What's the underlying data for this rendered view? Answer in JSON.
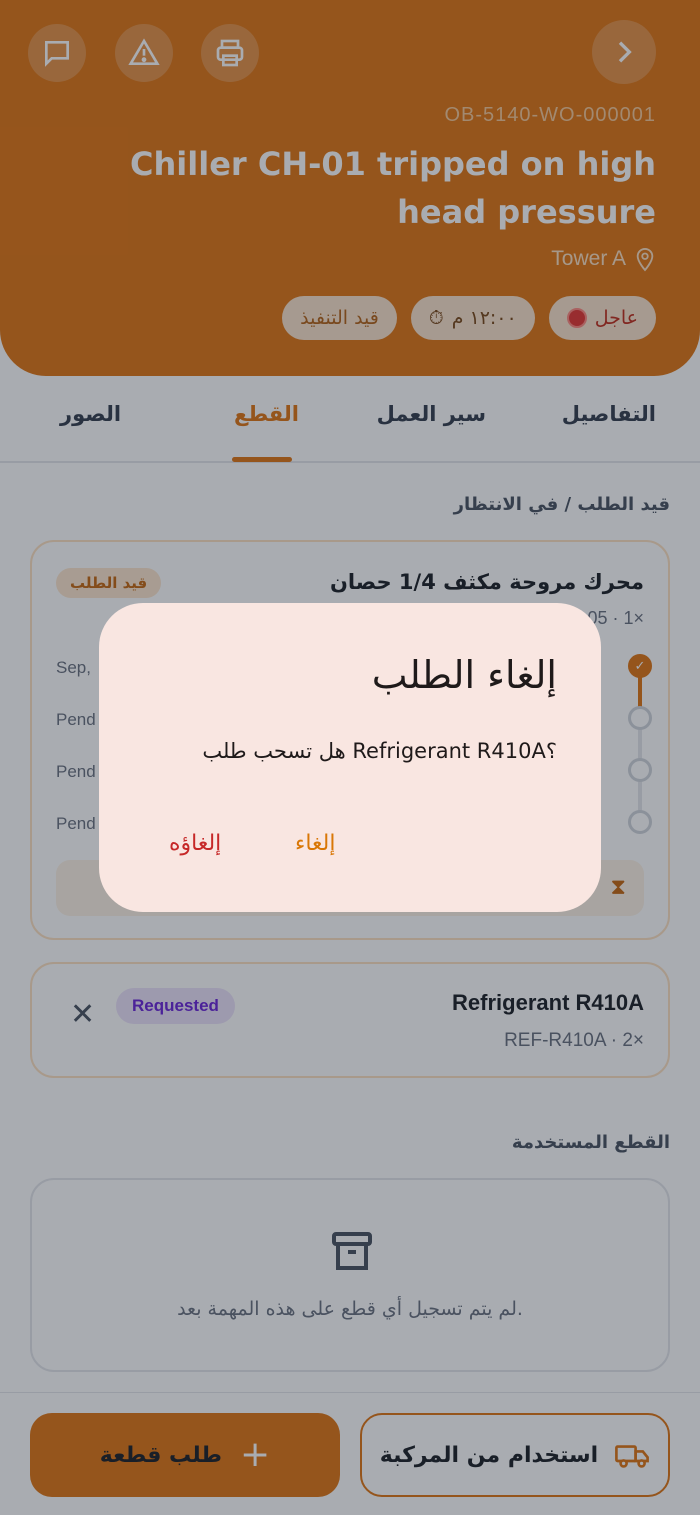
{
  "header": {
    "wo_id": "OB-5140-WO-000001",
    "title": "Chiller CH-01 tripped on high head pressure",
    "location": "Tower A",
    "chips": {
      "urgent": "عاجل",
      "time": "١٢:٠٠ م",
      "status": "قيد التنفيذ"
    }
  },
  "tabs": {
    "details": "التفاصيل",
    "workflow": "سير العمل",
    "parts": "القطع",
    "photos": "الصور"
  },
  "requested_section": {
    "label": "قيد الطلب / في الانتظار"
  },
  "part_card_1": {
    "name": "محرك مروحة مكثف 1/4 حصان",
    "badge": "قيد الطلب",
    "meta": "05 · 1×",
    "timeline": {
      "row1": "Sep,",
      "row2": "Pend",
      "row3": "Pend",
      "row4": "Pend"
    }
  },
  "part_card_2": {
    "name": "Refrigerant R410A",
    "meta": "REF-R410A · 2×",
    "badge": "Requested"
  },
  "used_section": {
    "label": "القطع المستخدمة",
    "empty_text": "لم يتم تسجيل أي قطع على هذه المهمة بعد."
  },
  "bottom": {
    "request_part": "طلب قطعة",
    "use_from_vehicle": "استخدام من المركبة"
  },
  "dialog": {
    "title": "إلغاء الطلب",
    "body": "هل تسحب طلب Refrigerant R410A؟",
    "cancel": "إلغاء",
    "confirm": "إلغاؤه"
  },
  "colors": {
    "accent": "#e07716",
    "urgent": "#e53935",
    "requested_badge": "#6d28d9",
    "dialog_bg": "#f9e6e1"
  }
}
